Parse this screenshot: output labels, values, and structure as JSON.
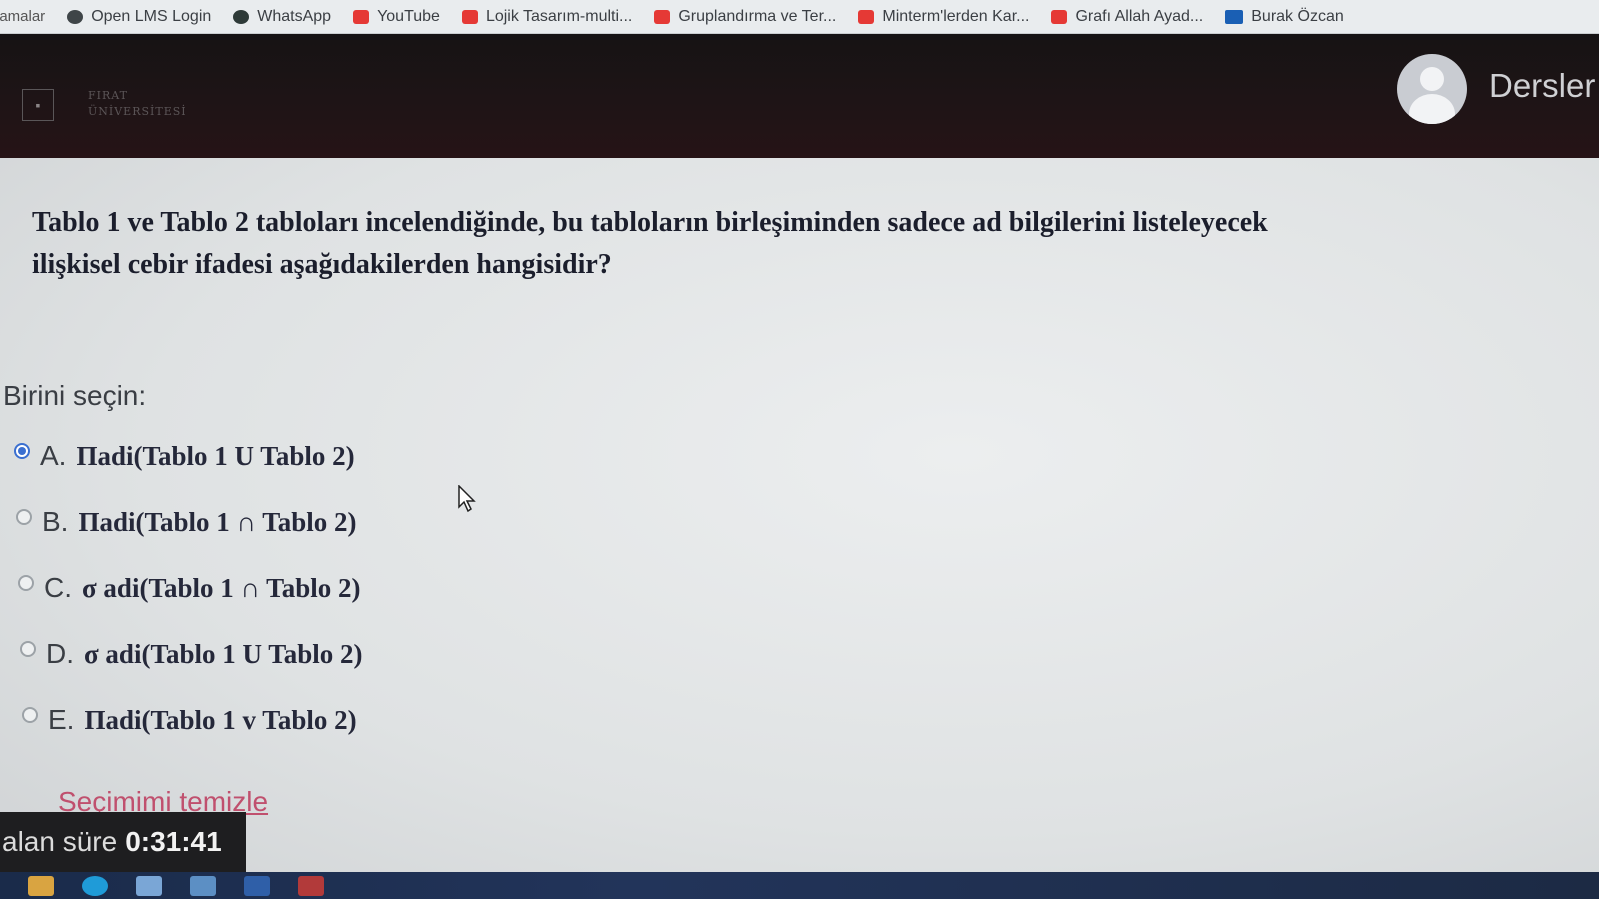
{
  "bookmarks": [
    {
      "label": "lamalar",
      "icon": ""
    },
    {
      "label": "Open LMS Login",
      "icon": "globe-icon"
    },
    {
      "label": "WhatsApp",
      "icon": "whatsapp-icon"
    },
    {
      "label": "YouTube",
      "icon": "youtube-icon"
    },
    {
      "label": "Lojik Tasarım-multi...",
      "icon": "youtube-icon"
    },
    {
      "label": "Gruplandırma ve Ter...",
      "icon": "youtube-icon"
    },
    {
      "label": "Minterm'lerden Kar...",
      "icon": "youtube-icon"
    },
    {
      "label": "Grafı Allah Ayad...",
      "icon": "youtube-icon"
    },
    {
      "label": "Burak Özcan",
      "icon": "bookmark-icon"
    }
  ],
  "header": {
    "logo_line1": "FIRAT",
    "logo_line2": "ÜNİVERSİTESİ",
    "nav_label": "Dersler"
  },
  "question": {
    "line1": "Tablo 1 ve Tablo 2 tabloları incelendiğinde, bu tabloların birleşiminden sadece ad bilgilerini listeleyecek",
    "line2": "ilişkisel cebir ifadesi aşağıdakilerden hangisidir?"
  },
  "prompt": "Birini seçin:",
  "options": [
    {
      "letter": "A.",
      "text": "Πadi(Tablo 1 U Tablo 2)",
      "selected": true
    },
    {
      "letter": "B.",
      "text": "Πadi(Tablo 1 ∩ Tablo 2)",
      "selected": false
    },
    {
      "letter": "C.",
      "text": "σ adi(Tablo 1 ∩ Tablo 2)",
      "selected": false
    },
    {
      "letter": "D.",
      "text": "σ adi(Tablo 1 U Tablo 2)",
      "selected": false
    },
    {
      "letter": "E.",
      "text": "Πadi(Tablo 1 v Tablo 2)",
      "selected": false
    }
  ],
  "clear_label": "Seçimimi temizle",
  "timer": {
    "label": "alan süre",
    "value": "0:31:41"
  },
  "colors": {
    "accent": "#3b6fd0",
    "link": "#c0506e",
    "header_bg": "#1c1415"
  }
}
